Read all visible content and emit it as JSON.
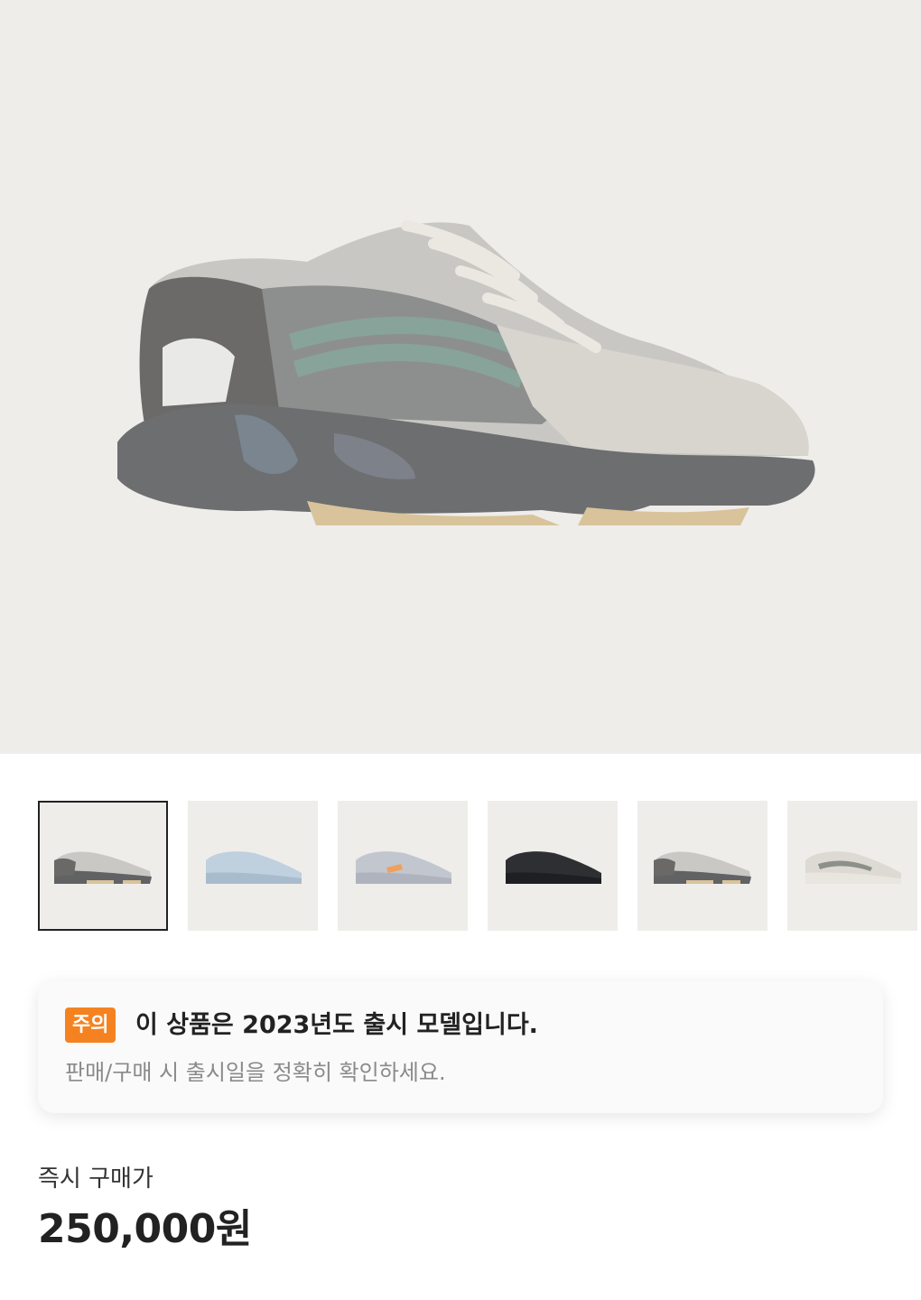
{
  "product": {
    "main_image": "sneaker-photo-gray-tephra",
    "thumbnails": [
      {
        "image": "sneaker-gray-tephra",
        "selected": true
      },
      {
        "image": "sneaker-light-blue"
      },
      {
        "image": "sneaker-inertia-gray-orange"
      },
      {
        "image": "sneaker-black-vanta"
      },
      {
        "image": "sneaker-gray-tephra-alt"
      },
      {
        "image": "sneaker-cream-static"
      }
    ]
  },
  "notice": {
    "badge": "주의",
    "title": "이 상품은 2023년도 출시 모델입니다.",
    "subtitle": "판매/구매 시 출시일을 정확히 확인하세요."
  },
  "price": {
    "label": "즉시 구매가",
    "value": "250,000원"
  },
  "colors": {
    "hero_background": "#efedea",
    "accent_badge": "#f58220"
  }
}
